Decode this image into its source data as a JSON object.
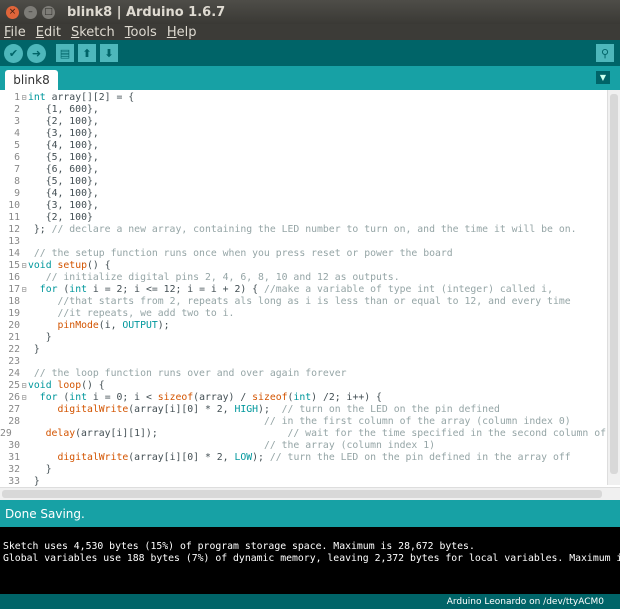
{
  "window": {
    "title": "blink8 | Arduino 1.6.7",
    "close": "×",
    "minimize": "–",
    "maximize": "□"
  },
  "menu": [
    {
      "mn": "F",
      "rest": "ile"
    },
    {
      "mn": "E",
      "rest": "dit"
    },
    {
      "mn": "S",
      "rest": "ketch"
    },
    {
      "mn": "T",
      "rest": "ools"
    },
    {
      "mn": "H",
      "rest": "elp"
    }
  ],
  "toolbar": {
    "verify_icon": "check-icon",
    "upload_icon": "arrow-right-icon",
    "new_icon": "new-file-icon",
    "open_icon": "arrow-up-icon",
    "save_icon": "arrow-down-icon",
    "monitor_icon": "magnifier-icon"
  },
  "tabs": [
    {
      "label": "blink8"
    }
  ],
  "code_lines": [
    [
      {
        "t": "int",
        "c": "kw"
      },
      {
        "t": " array[][2] = {"
      }
    ],
    [
      {
        "t": "   {1, 600},"
      }
    ],
    [
      {
        "t": "   {2, 100},"
      }
    ],
    [
      {
        "t": "   {3, 100},"
      }
    ],
    [
      {
        "t": "   {4, 100},"
      }
    ],
    [
      {
        "t": "   {5, 100},"
      }
    ],
    [
      {
        "t": "   {6, 600},"
      }
    ],
    [
      {
        "t": "   {5, 100},"
      }
    ],
    [
      {
        "t": "   {4, 100},"
      }
    ],
    [
      {
        "t": "   {3, 100},"
      }
    ],
    [
      {
        "t": "   {2, 100}"
      }
    ],
    [
      {
        "t": " }; "
      },
      {
        "t": "// declare a new array, containing the LED number to turn on, and the time it will be on.",
        "c": "cm"
      }
    ],
    [
      {
        "t": ""
      }
    ],
    [
      {
        "t": " "
      },
      {
        "t": "// the setup function runs once when you press reset or power the board",
        "c": "cm"
      }
    ],
    [
      {
        "t": "void",
        "c": "kw"
      },
      {
        "t": " "
      },
      {
        "t": "setup",
        "c": "fn"
      },
      {
        "t": "() {"
      }
    ],
    [
      {
        "t": "   "
      },
      {
        "t": "// initialize digital pins 2, 4, 6, 8, 10 and 12 as outputs.",
        "c": "cm"
      }
    ],
    [
      {
        "t": "  "
      },
      {
        "t": "for",
        "c": "kw"
      },
      {
        "t": " ("
      },
      {
        "t": "int",
        "c": "kw"
      },
      {
        "t": " i = 2; i <= 12; i = i + 2) { "
      },
      {
        "t": "//make a variable of type int (integer) called i,",
        "c": "cm"
      }
    ],
    [
      {
        "t": "     "
      },
      {
        "t": "//that starts from 2, repeats als long as i is less than or equal to 12, and every time",
        "c": "cm"
      }
    ],
    [
      {
        "t": "     "
      },
      {
        "t": "//it repeats, we add two to i.",
        "c": "cm"
      }
    ],
    [
      {
        "t": "     "
      },
      {
        "t": "pinMode",
        "c": "fn"
      },
      {
        "t": "(i, "
      },
      {
        "t": "OUTPUT",
        "c": "cst"
      },
      {
        "t": ");"
      }
    ],
    [
      {
        "t": "   }"
      }
    ],
    [
      {
        "t": " }"
      }
    ],
    [
      {
        "t": ""
      }
    ],
    [
      {
        "t": " "
      },
      {
        "t": "// the loop function runs over and over again forever",
        "c": "cm"
      }
    ],
    [
      {
        "t": "void",
        "c": "kw"
      },
      {
        "t": " "
      },
      {
        "t": "loop",
        "c": "fn"
      },
      {
        "t": "() {"
      }
    ],
    [
      {
        "t": "  "
      },
      {
        "t": "for",
        "c": "kw"
      },
      {
        "t": " ("
      },
      {
        "t": "int",
        "c": "kw"
      },
      {
        "t": " i = 0; i < "
      },
      {
        "t": "sizeof",
        "c": "fn"
      },
      {
        "t": "(array) / "
      },
      {
        "t": "sizeof",
        "c": "fn"
      },
      {
        "t": "("
      },
      {
        "t": "int",
        "c": "kw"
      },
      {
        "t": ") /2; i++) {"
      }
    ],
    [
      {
        "t": "     "
      },
      {
        "t": "digitalWrite",
        "c": "fn"
      },
      {
        "t": "(array[i][0] * 2, "
      },
      {
        "t": "HIGH",
        "c": "cst"
      },
      {
        "t": ");  "
      },
      {
        "t": "// turn on the LED on the pin defined",
        "c": "cm"
      }
    ],
    [
      {
        "t": "                                        "
      },
      {
        "t": "// in the first column of the array (column index 0)",
        "c": "cm"
      }
    ],
    [
      {
        "t": "     "
      },
      {
        "t": "delay",
        "c": "fn"
      },
      {
        "t": "(array[i][1]);                      "
      },
      {
        "t": "// wait for the time specified in the second column of",
        "c": "cm"
      }
    ],
    [
      {
        "t": "                                        "
      },
      {
        "t": "// the array (column index 1)",
        "c": "cm"
      }
    ],
    [
      {
        "t": "     "
      },
      {
        "t": "digitalWrite",
        "c": "fn"
      },
      {
        "t": "(array[i][0] * 2, "
      },
      {
        "t": "LOW",
        "c": "cst"
      },
      {
        "t": "); "
      },
      {
        "t": "// turn the LED on the pin defined in the array off",
        "c": "cm"
      }
    ],
    [
      {
        "t": "   }"
      }
    ],
    [
      {
        "t": " }"
      }
    ]
  ],
  "fold_lines": [
    1,
    15,
    17,
    25,
    26
  ],
  "fold_glyph": "⊟",
  "status": {
    "message": "Done Saving."
  },
  "console": {
    "lines": [
      "Sketch uses 4,530 bytes (15%) of program storage space. Maximum is 28,672 bytes.",
      "Global variables use 188 bytes (7%) of dynamic memory, leaving 2,372 bytes for local variables. Maximum is 2"
    ]
  },
  "footer": {
    "board": "Arduino Leonardo on /dev/ttyACM0"
  },
  "tab_menu_glyph": "▼",
  "colors": {
    "toolbar": "#006468",
    "tabbar": "#17a1a5",
    "keyword": "#00979c",
    "function": "#d35400",
    "comment": "#95a5a6"
  }
}
